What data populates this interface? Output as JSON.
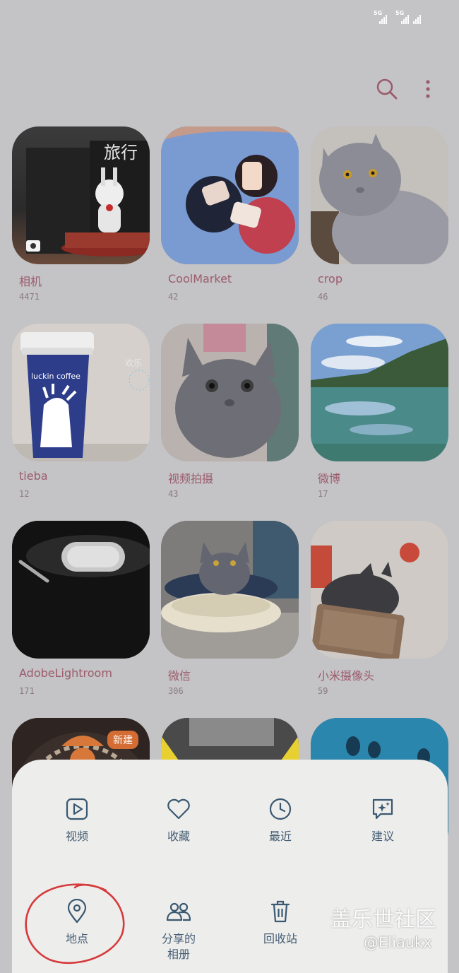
{
  "status_bar": {
    "network_1": "5G",
    "network_2": "5G"
  },
  "toolbar": {
    "search_icon": "search-icon",
    "more_icon": "more-vertical-icon"
  },
  "albums": [
    {
      "name": "相机",
      "count": "4471"
    },
    {
      "name": "CoolMarket",
      "count": "42"
    },
    {
      "name": "crop",
      "count": "46"
    },
    {
      "name": "tieba",
      "count": "12"
    },
    {
      "name": "视频拍摄",
      "count": "43"
    },
    {
      "name": "微博",
      "count": "17"
    },
    {
      "name": "AdobeLightroom",
      "count": "171"
    },
    {
      "name": "微信",
      "count": "306"
    },
    {
      "name": "小米摄像头",
      "count": "59"
    }
  ],
  "thumbnail_text": {
    "album_1_title": "旅行",
    "album_4_cup_brand": "luckin coffee",
    "album_4_banner": "欢乐"
  },
  "new_badge": "新建",
  "menu": {
    "video": "视频",
    "favorites": "收藏",
    "recent": "最近",
    "suggestions": "建议",
    "places": "地点",
    "shared_albums": "分享的相册",
    "recycle_bin": "回收站"
  },
  "watermark": {
    "title": "盖乐世社区",
    "user": "@Eliaukx"
  },
  "colors": {
    "background": "#c4c3c5",
    "sheet": "#ededec",
    "menu_icon": "#3a5870",
    "album_name": "#9b5b6c",
    "annotation_circle": "#d63a3a"
  }
}
